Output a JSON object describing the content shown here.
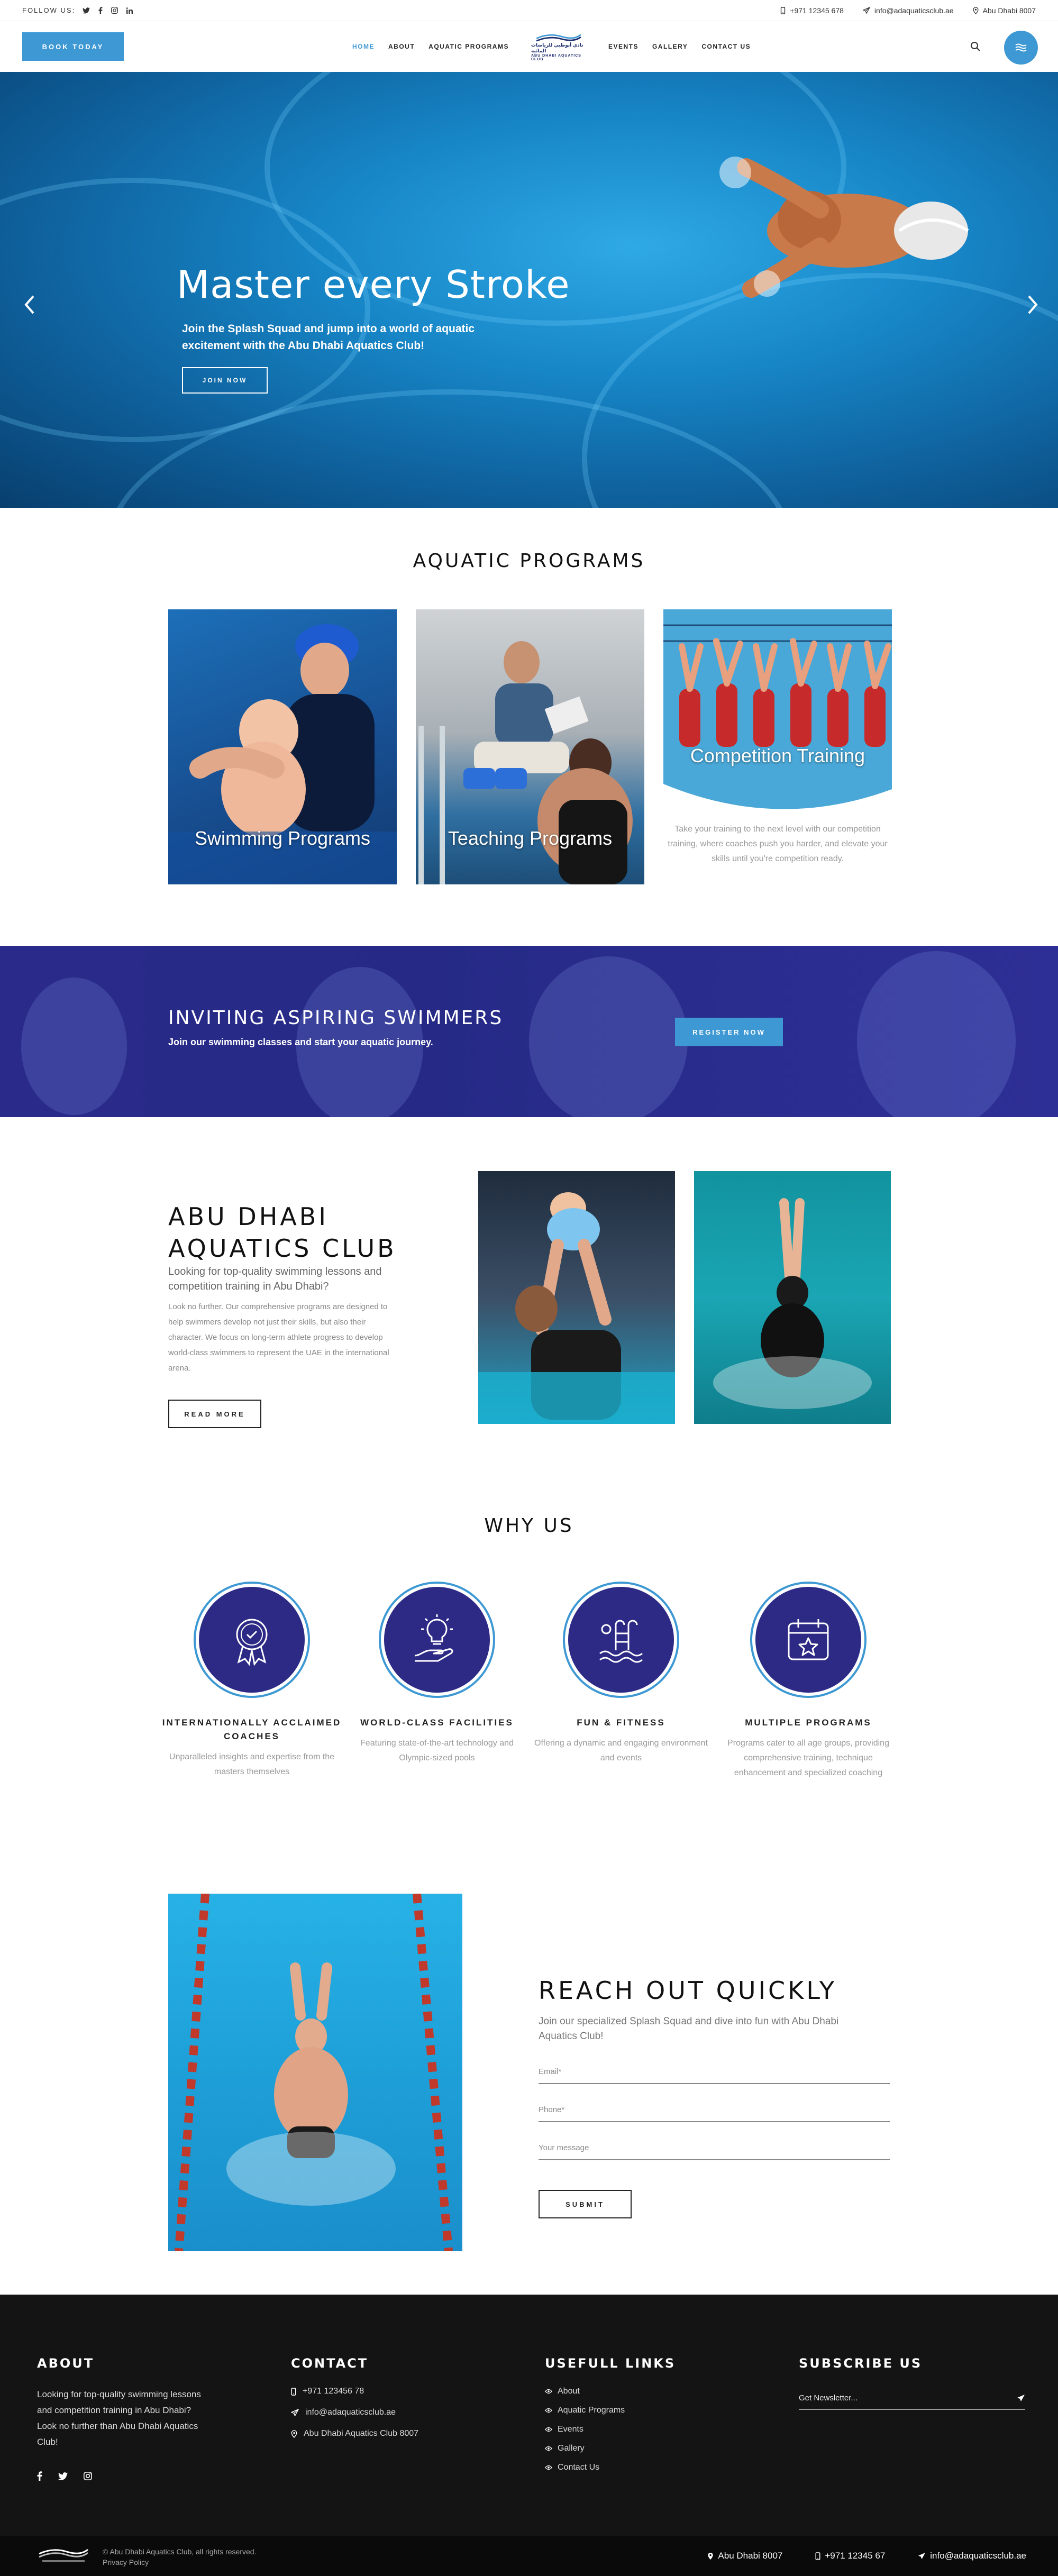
{
  "topbar": {
    "follow_label": "FOLLOW US:",
    "social_icons": [
      "twitter-icon",
      "facebook-icon",
      "instagram-icon",
      "linkedin-icon"
    ],
    "phone": "+971 12345 678",
    "email": "info@adaquaticsclub.ae",
    "address": "Abu Dhabi 8007"
  },
  "header": {
    "book_label": "BOOK TODAY",
    "nav": [
      "HOME",
      "ABOUT",
      "AQUATIC PROGRAMS",
      "EVENTS",
      "GALLERY",
      "CONTACT US"
    ],
    "active_nav": "HOME",
    "logo_text_ar": "نادي أبوظبي للرياضات المائية",
    "logo_text_en": "ABU DHABI AQUATICS CLUB"
  },
  "hero": {
    "title": "Master every Stroke",
    "subtitle": "Join the Splash Squad and jump into a world of aquatic excitement with the Abu Dhabi Aquatics Club!",
    "button": "JOIN NOW"
  },
  "programs": {
    "title": "AQUATIC PROGRAMS",
    "items": [
      {
        "label": "Swimming Programs"
      },
      {
        "label": "Teaching Programs"
      },
      {
        "label": "Competition Training",
        "description": "Take your training to the next level with our competition training, where coaches push you harder, and elevate your skills until you're competition ready."
      }
    ]
  },
  "band": {
    "title": "INVITING ASPIRING SWIMMERS",
    "subtitle": "Join our swimming classes and start your aquatic journey.",
    "button": "REGISTER NOW"
  },
  "about": {
    "title_line1": "ABU DHABI",
    "title_line2": "AQUATICS CLUB",
    "lead": "Looking for top-quality swimming lessons and competition training in Abu Dhabi?",
    "body": "Look no further. Our comprehensive programs are designed to help swimmers develop not just their skills, but also their character. We focus on long-term athlete progress to develop world-class swimmers to represent the UAE in the international arena.",
    "button": "READ MORE"
  },
  "why": {
    "title": "WHY US",
    "items": [
      {
        "icon": "medal-icon",
        "title": "INTERNATIONALLY ACCLAIMED COACHES",
        "text": "Unparalleled insights and expertise from the masters themselves"
      },
      {
        "icon": "lightbulb-hand-icon",
        "title": "WORLD-CLASS FACILITIES",
        "text": "Featuring state-of-the-art technology and Olympic-sized pools"
      },
      {
        "icon": "pool-icon",
        "title": "FUN & FITNESS",
        "text": "Offering a dynamic and engaging environment and events"
      },
      {
        "icon": "calendar-star-icon",
        "title": "MULTIPLE PROGRAMS",
        "text": "Programs cater to all age groups, providing comprehensive training, technique enhancement and specialized coaching"
      }
    ]
  },
  "contact": {
    "title": "REACH OUT QUICKLY",
    "subtitle": "Join our specialized Splash Squad and dive into fun with Abu Dhabi Aquatics Club!",
    "email_placeholder": "Email*",
    "phone_placeholder": "Phone*",
    "message_placeholder": "Your message",
    "submit": "SUBMIT"
  },
  "footer": {
    "about_title": "ABOUT",
    "about_text": "Looking for top-quality swimming lessons and competition training in Abu Dhabi? Look no further than Abu Dhabi Aquatics Club!",
    "contact_title": "CONTACT",
    "contact_phone": "+971 123456 78",
    "contact_email": "info@adaquaticsclub.ae",
    "contact_address": "Abu Dhabi Aquatics Club 8007",
    "links_title": "USEFULL LINKS",
    "links": [
      "About",
      "Aquatic Programs",
      "Events",
      "Gallery",
      "Contact Us"
    ],
    "subscribe_title": "SUBSCRIBE US",
    "newsletter_placeholder": "Get Newsletter...",
    "copyright": "© Abu Dhabi Aquatics Club, all rights reserved.",
    "privacy": "Privacy Policy",
    "bottom_address": "Abu Dhabi 8007",
    "bottom_phone": "+971 12345 67",
    "bottom_email": "info@adaquaticsclub.ae"
  },
  "colors": {
    "accent": "#3d98d3",
    "band": "#2a2a8a",
    "icon_circle": "#2d2a86",
    "footer": "#141414"
  }
}
